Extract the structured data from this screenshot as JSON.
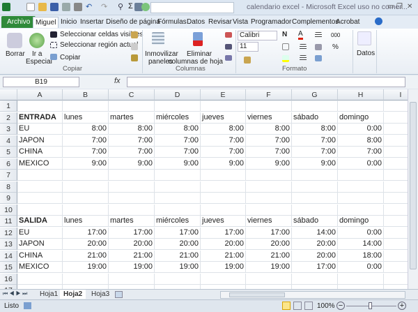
{
  "window": {
    "title": "calendario excel - Microsoft Excel uso no comer..."
  },
  "tabs": [
    "Archivo",
    "Miguel",
    "Inicio",
    "Insertar",
    "Diseño de página",
    "Fórmulas",
    "Datos",
    "Revisar",
    "Vista",
    "Programador",
    "Complementos",
    "Acrobat"
  ],
  "ribbon": {
    "copiar": {
      "borrar": "Borrar",
      "ir_a": "Ir a",
      "especial": "Especial",
      "sel_visibles": "Seleccionar celdas visibles",
      "sel_region": "Seleccionar región actual",
      "copiar": "Copiar",
      "group": "Copiar"
    },
    "columnas": {
      "inmov1": "Inmovilizar",
      "inmov2": "paneles",
      "elim1": "Eliminar",
      "elim2": "columnas de hoja",
      "group": "Columnas"
    },
    "formato": {
      "font": "Calibri",
      "size": "11",
      "bold": "N",
      "group": "Formato",
      "pct": "%",
      "thousands": "000"
    },
    "datos": {
      "label": "Datos"
    }
  },
  "formula": {
    "name_box": "B19",
    "fx": "fx",
    "value": ""
  },
  "columns": [
    "A",
    "B",
    "C",
    "D",
    "E",
    "F",
    "G",
    "H",
    "I"
  ],
  "rows": [
    [
      "",
      "",
      " ",
      "",
      "",
      "",
      "",
      "",
      ""
    ],
    [
      "ENTRADA",
      "lunes",
      "martes",
      "miércoles",
      "jueves",
      "viernes",
      "sábado",
      "domingo"
    ],
    [
      "EU",
      "8:00",
      "8:00",
      "8:00",
      "8:00",
      "8:00",
      "8:00",
      "0:00"
    ],
    [
      "JAPON",
      "7:00",
      "7:00",
      "7:00",
      "7:00",
      "7:00",
      "7:00",
      "8:00"
    ],
    [
      "CHINA",
      "7:00",
      "7:00",
      "7:00",
      "7:00",
      "7:00",
      "7:00",
      "7:00"
    ],
    [
      "MEXICO",
      "9:00",
      "9:00",
      "9:00",
      "9:00",
      "9:00",
      "9:00",
      "0:00"
    ],
    [],
    [],
    [],
    [],
    [
      "SALIDA",
      "lunes",
      "martes",
      "miércoles",
      "jueves",
      "viernes",
      "sábado",
      "domingo"
    ],
    [
      "EU",
      "17:00",
      "17:00",
      "17:00",
      "17:00",
      "17:00",
      "14:00",
      "0:00"
    ],
    [
      "JAPON",
      "20:00",
      "20:00",
      "20:00",
      "20:00",
      "20:00",
      "20:00",
      "14:00"
    ],
    [
      "CHINA",
      "21:00",
      "21:00",
      "21:00",
      "21:00",
      "21:00",
      "20:00",
      "18:00"
    ],
    [
      "MEXICO",
      "19:00",
      "19:00",
      "19:00",
      "19:00",
      "19:00",
      "17:00",
      "0:00"
    ],
    [],
    [],
    []
  ],
  "sheets": [
    "Hoja1",
    "Hoja2",
    "Hoja3"
  ],
  "active_sheet": "Hoja2",
  "status": {
    "ready": "Listo",
    "zoom": "100%"
  }
}
